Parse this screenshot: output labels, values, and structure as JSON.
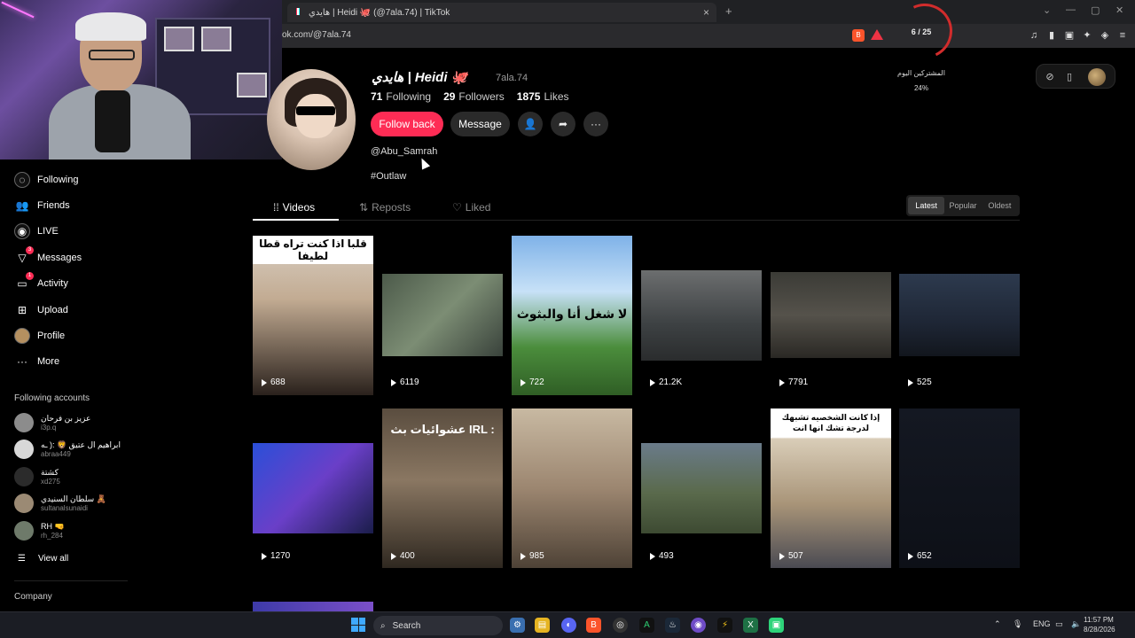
{
  "browser": {
    "tab_title": "هايدي | Heidi 🐙 (@7ala.74) | TikTok",
    "url": "ok.com/@7ala.74",
    "new_tab": "+",
    "close": "×"
  },
  "stream_hud": {
    "count": "6 / 25",
    "label": "المشتركين اليوم",
    "percent": "24%"
  },
  "profile": {
    "name": "هايدي | Heidi 🐙",
    "username": "7ala.74",
    "following_count": "71",
    "following_label": "Following",
    "followers_count": "29",
    "followers_label": "Followers",
    "likes_count": "1875",
    "likes_label": "Likes",
    "follow_back": "Follow back",
    "message": "Message",
    "bio_line1": "@Abu_Samrah",
    "bio_line2": "#Outlaw"
  },
  "profile_tabs": [
    {
      "label": "Videos",
      "icon": "grid-icon"
    },
    {
      "label": "Reposts",
      "icon": "repost-icon"
    },
    {
      "label": "Liked",
      "icon": "heart-icon"
    }
  ],
  "sort": [
    "Latest",
    "Popular",
    "Oldest"
  ],
  "sidebar": {
    "nav": [
      {
        "label": "Following",
        "icon": "following-icon"
      },
      {
        "label": "Friends",
        "icon": "friends-icon"
      },
      {
        "label": "LIVE",
        "icon": "live-icon"
      },
      {
        "label": "Messages",
        "icon": "messages-icon",
        "badge": "3"
      },
      {
        "label": "Activity",
        "icon": "activity-icon",
        "badge": "1"
      },
      {
        "label": "Upload",
        "icon": "upload-icon"
      },
      {
        "label": "Profile",
        "icon": "profile-icon"
      },
      {
        "label": "More",
        "icon": "more-icon"
      }
    ],
    "following_title": "Following accounts",
    "accounts": [
      {
        "name": "عزيز بن فرحان",
        "handle": "i3p.q"
      },
      {
        "name": "ابراهيم ال عتيق 🦁 :(  ـه",
        "handle": "abraa449"
      },
      {
        "name": "كشتة",
        "handle": "xd275"
      },
      {
        "name": "سلطان السنيدي 🧸",
        "handle": "sultanalsunaidi"
      },
      {
        "name": "RH 🤜",
        "handle": "rh_284"
      }
    ],
    "view_all": "View all",
    "company": "Company"
  },
  "videos": [
    {
      "views": "688",
      "caption": "قلبا اذا كنت تراه قطا لطيفا"
    },
    {
      "views": "6119",
      "caption": ""
    },
    {
      "views": "722",
      "caption": "لا شغل أنا والبثوث"
    },
    {
      "views": "21.2K",
      "caption": ""
    },
    {
      "views": "7791",
      "caption": ""
    },
    {
      "views": "525",
      "caption": ""
    },
    {
      "views": "1270",
      "caption": ""
    },
    {
      "views": "400",
      "caption": "عشوائيات بث IRL :"
    },
    {
      "views": "985",
      "caption": ""
    },
    {
      "views": "493",
      "caption": ""
    },
    {
      "views": "507",
      "caption": "إذا كانت الشخصيه تشبهك لدرجة تشك انها انت"
    },
    {
      "views": "652",
      "caption": ""
    }
  ],
  "taskbar": {
    "search": "Search",
    "lang": "ENG",
    "time": "11:57 PM",
    "date": "8/28/2026"
  },
  "colors": {
    "accent": "#fe2c55",
    "background": "#000000"
  }
}
